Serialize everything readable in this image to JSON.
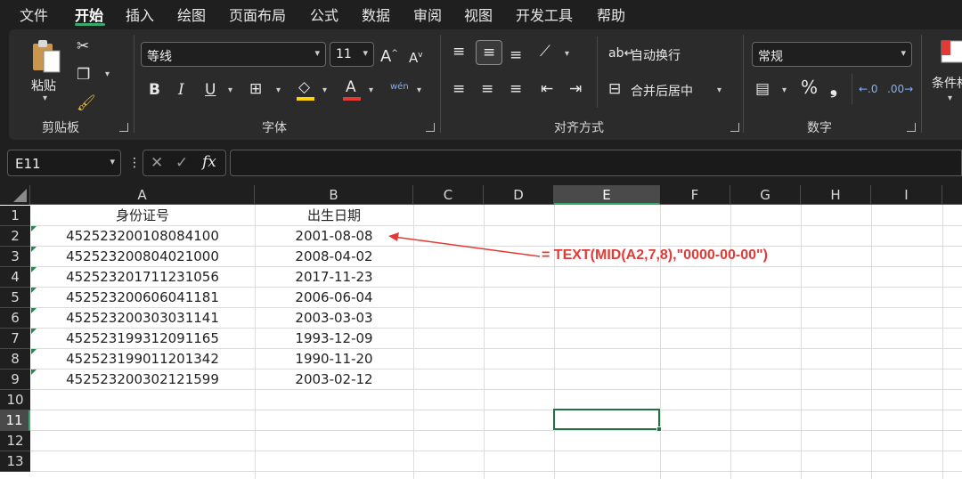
{
  "menu": [
    "文件",
    "开始",
    "插入",
    "绘图",
    "页面布局",
    "公式",
    "数据",
    "审阅",
    "视图",
    "开发工具",
    "帮助"
  ],
  "ribbon": {
    "clipboard": {
      "paste_label": "粘贴",
      "group_label": "剪贴板"
    },
    "font": {
      "font_name": "等线",
      "font_size": "11",
      "group_label": "字体",
      "wen_label": "wén"
    },
    "alignment": {
      "wrap_label": "自动换行",
      "merge_label": "合并后居中",
      "group_label": "对齐方式"
    },
    "number": {
      "format": "常规",
      "percent": "%",
      "comma": "❟",
      "group_label": "数字"
    },
    "styles": {
      "cond_label": "条件格"
    }
  },
  "formula_bar": {
    "name_box": "E11",
    "fx": "fx",
    "content": ""
  },
  "sheet": {
    "columns": [
      "A",
      "B",
      "C",
      "D",
      "E",
      "F",
      "G",
      "H",
      "I"
    ],
    "rows": [
      "1",
      "2",
      "3",
      "4",
      "5",
      "6",
      "7",
      "8",
      "9",
      "10",
      "11",
      "12",
      "13"
    ],
    "header": {
      "a": "身份证号",
      "b": "出生日期"
    },
    "data": [
      {
        "id": "452523200108084100",
        "date": "2001-08-08"
      },
      {
        "id": "452523200804021000",
        "date": "2008-04-02"
      },
      {
        "id": "452523201711231056",
        "date": "2017-11-23"
      },
      {
        "id": "452523200606041181",
        "date": "2006-06-04"
      },
      {
        "id": "452523200303031141",
        "date": "2003-03-03"
      },
      {
        "id": "452523199312091165",
        "date": "1993-12-09"
      },
      {
        "id": "452523199011201342",
        "date": "1990-11-20"
      },
      {
        "id": "452523200302121599",
        "date": "2003-02-12"
      }
    ],
    "selected_cell": "E11"
  },
  "annotation": {
    "text": "= TEXT(MID(A2,7,8),\"0000-00-00\")",
    "color": "#e53935"
  }
}
